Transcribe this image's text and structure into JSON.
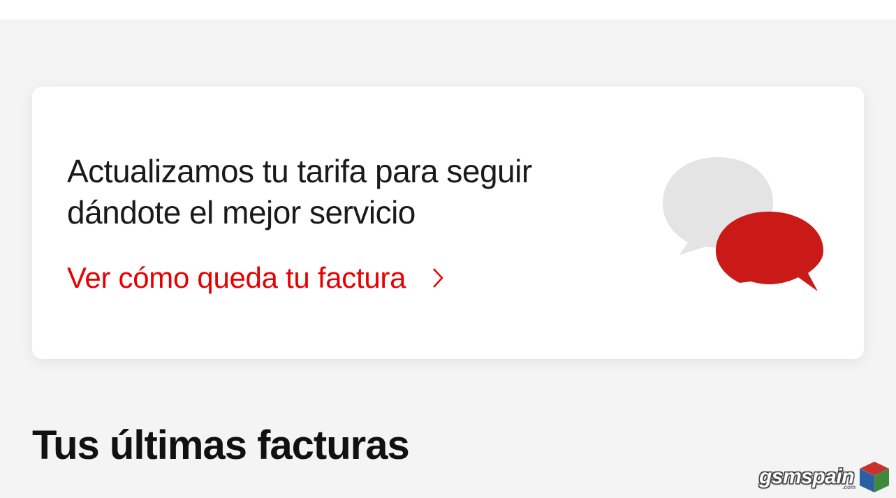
{
  "card": {
    "title": "Actualizamos tu tarifa para seguir dándote el mejor servicio",
    "link_label": "Ver cómo queda tu factura"
  },
  "section": {
    "heading": "Tus últimas facturas"
  },
  "icons": {
    "chat_bubbles": "chat-bubbles-icon",
    "chevron_right": "chevron-right-icon",
    "gsmspain_cube": "gsmspain-cube-icon"
  },
  "watermark": {
    "text": "gsmspain",
    "suffix": ".com"
  },
  "colors": {
    "accent": "#e60000",
    "bubble_gray": "#e4e4e4",
    "bubble_red": "#ca1a17",
    "page_bg": "#f4f4f4"
  }
}
